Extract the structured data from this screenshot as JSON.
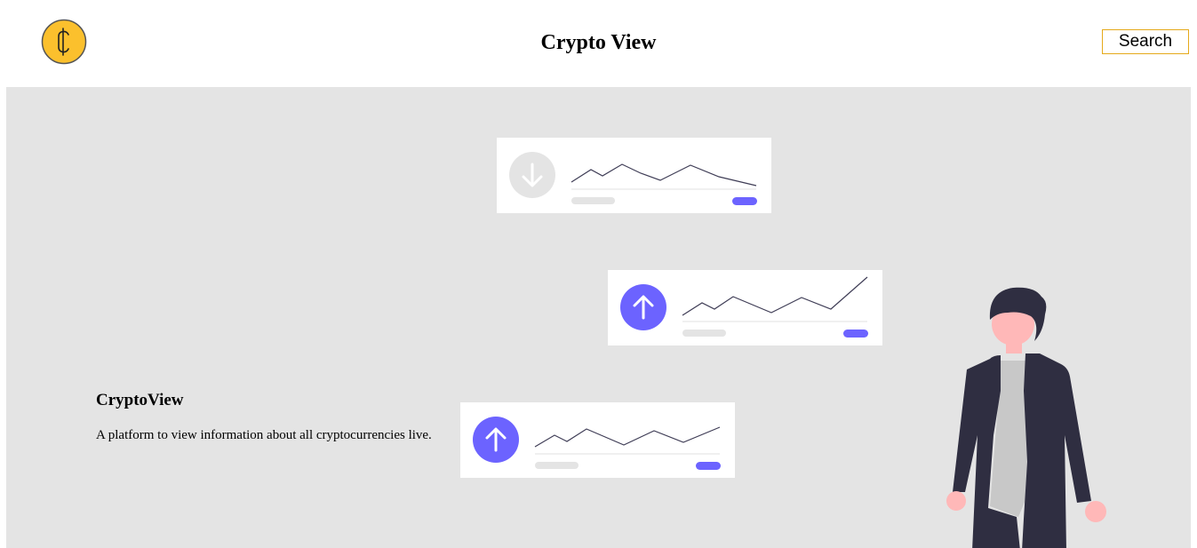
{
  "header": {
    "title": "Crypto View",
    "search_label": "Search",
    "logo_icon": "coin-cent-icon"
  },
  "hero": {
    "heading": "CryptoView",
    "description": "A platform to view information about all cryptocurrencies live."
  },
  "cards": [
    {
      "trend": "down",
      "icon": "arrow-down-icon"
    },
    {
      "trend": "up",
      "icon": "arrow-up-icon"
    },
    {
      "trend": "up",
      "icon": "arrow-up-icon"
    }
  ],
  "colors": {
    "accent": "#6c63ff",
    "brand_yellow": "#fbc02d",
    "search_border": "#e5a91a",
    "hero_background": "#e4e4e4"
  }
}
